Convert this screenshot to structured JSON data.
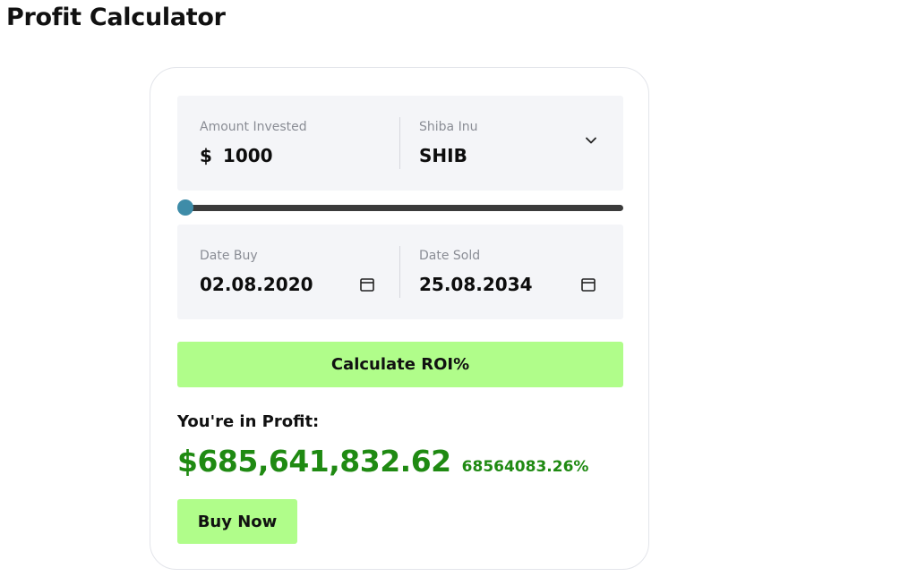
{
  "page": {
    "title": "Profit Calculator"
  },
  "investment": {
    "amount_label": "Amount Invested",
    "currency_symbol": "$",
    "amount_value": "1000",
    "coin_label": "Shiba Inu",
    "coin_symbol": "SHIB",
    "dropdown_icon": "chevron-down-icon"
  },
  "slider": {
    "level_fraction": 0.0
  },
  "dates": {
    "buy_label": "Date Buy",
    "buy_value": "02.08.2020",
    "sold_label": "Date Sold",
    "sold_value": "25.08.2034",
    "icon": "calendar-icon"
  },
  "actions": {
    "calculate_label": "Calculate ROI%",
    "buy_label": "Buy Now"
  },
  "result": {
    "heading": "You're in Profit:",
    "amount": "$685,641,832.62",
    "percent": "68564083.26%"
  },
  "colors": {
    "accent_button": "#b0fd8a",
    "profit_green": "#1f8a12",
    "slider_thumb": "#3e8ca8",
    "slider_track": "#3b3b3b",
    "panel_bg": "#f4f5f8"
  }
}
